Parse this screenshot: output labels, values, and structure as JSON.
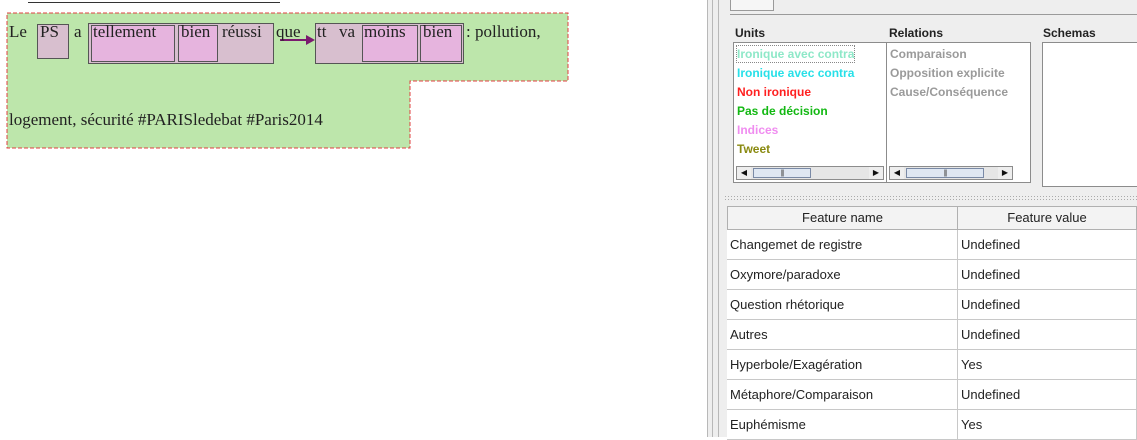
{
  "annotated_text": {
    "line1": {
      "le": "Le",
      "ps": "PS",
      "a": "a",
      "tellement": "tellement",
      "bien1": "bien",
      "reussi": "réussi",
      "que": "que",
      "tt": "tt",
      "va": "va",
      "moins": "moins",
      "bien2": "bien",
      "rest": ": pollution,"
    },
    "line2": "logement, sécurité #PARISledebat #Paris2014",
    "colors": {
      "unit_fill": "#bde6ab",
      "unit_border": "#e04040",
      "mauve_box": "#d8bfcf",
      "pink_box": "#e6b4de",
      "arrow": "#7a1a6e"
    }
  },
  "panel": {
    "units_label": "Units",
    "relations_label": "Relations",
    "schemas_label": "Schemas",
    "units": [
      {
        "text": "Ironique avec contra",
        "color": "#8ee8c8"
      },
      {
        "text": "Ironique avec contra",
        "color": "#27e0e8"
      },
      {
        "text": "Non ironique",
        "color": "#ff2020"
      },
      {
        "text": "Pas de décision",
        "color": "#12b812"
      },
      {
        "text": "Indices",
        "color": "#f08cf0"
      },
      {
        "text": "Tweet",
        "color": "#8a8a10"
      }
    ],
    "relations": [
      {
        "text": "Comparaison"
      },
      {
        "text": "Opposition explicite"
      },
      {
        "text": "Cause/Conséquence"
      }
    ],
    "table": {
      "col_name": "Feature name",
      "col_value": "Feature value",
      "rows": [
        {
          "name": "Changemet de registre",
          "value": "Undefined"
        },
        {
          "name": "Oxymore/paradoxe",
          "value": "Undefined"
        },
        {
          "name": "Question rhétorique",
          "value": "Undefined"
        },
        {
          "name": "Autres",
          "value": "Undefined"
        },
        {
          "name": "Hyperbole/Exagération",
          "value": "Yes"
        },
        {
          "name": "Métaphore/Comparaison",
          "value": "Undefined"
        },
        {
          "name": "Euphémisme",
          "value": "Yes"
        }
      ]
    },
    "scroll_glyphs": {
      "left": "◀",
      "right": "▶",
      "grip": "|||"
    }
  }
}
